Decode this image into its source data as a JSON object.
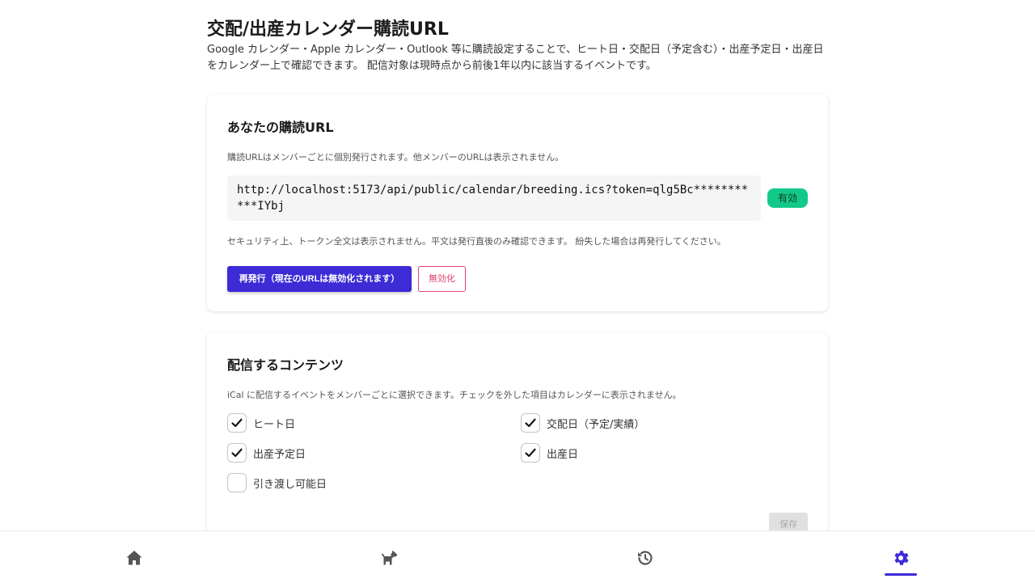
{
  "page": {
    "title": "交配/出産カレンダー購読URL",
    "description": "Google カレンダー・Apple カレンダー・Outlook 等に購読設定することで、ヒート日・交配日（予定含む）・出産予定日・出産日をカレンダー上で確認できます。 配信対象は現時点から前後1年以内に該当するイベントです。"
  },
  "subscription": {
    "title": "あなたの購読URL",
    "note": "購読URLはメンバーごとに個別発行されます。他メンバーのURLは表示されません。",
    "url": "http://localhost:5173/api/public/calendar/breeding.ics?token=qlg5Bc***********IYbj",
    "status_badge": "有効",
    "security_note": "セキュリティ上、トークン全文は表示されません。平文は発行直後のみ確認できます。 紛失した場合は再発行してください。",
    "reissue_button": "再発行（現在のURLは無効化されます）",
    "disable_button": "無効化"
  },
  "content_settings": {
    "title": "配信するコンテンツ",
    "note": "iCal に配信するイベントをメンバーごとに選択できます。チェックを外した項目はカレンダーに表示されません。",
    "options": [
      {
        "label": "ヒート日",
        "checked": true
      },
      {
        "label": "交配日（予定/実績）",
        "checked": true
      },
      {
        "label": "出産予定日",
        "checked": true
      },
      {
        "label": "出産日",
        "checked": true
      },
      {
        "label": "引き渡し可能日",
        "checked": false
      }
    ],
    "save_button": "保存"
  },
  "nav": {
    "items": [
      {
        "icon": "home-icon",
        "active": false
      },
      {
        "icon": "dog-icon",
        "active": false
      },
      {
        "icon": "history-icon",
        "active": false
      },
      {
        "icon": "gear-icon",
        "active": true
      }
    ]
  },
  "colors": {
    "accent": "#3d2bd6",
    "valid_badge": "#12c98a",
    "danger": "#e0436c",
    "nav_inactive": "#555555"
  }
}
